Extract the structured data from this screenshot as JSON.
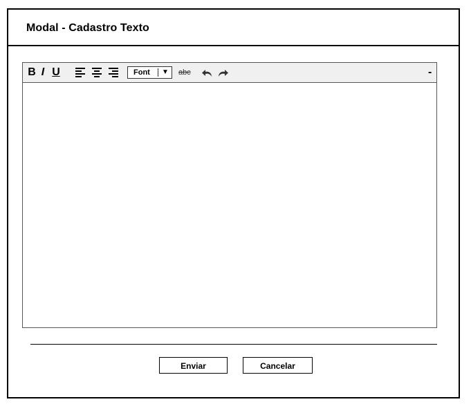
{
  "modal": {
    "title": "Modal - Cadastro Texto"
  },
  "toolbar": {
    "bold": "B",
    "italic": "I",
    "underline": "U",
    "font_select": "Font",
    "font_caret": "▼",
    "strikethrough": "abc",
    "collapse": "-",
    "icons": [
      "align-left-icon",
      "align-center-icon",
      "align-right-icon",
      "undo-icon",
      "redo-icon"
    ]
  },
  "editor": {
    "content": ""
  },
  "actions": {
    "send": "Enviar",
    "cancel": "Cancelar"
  }
}
